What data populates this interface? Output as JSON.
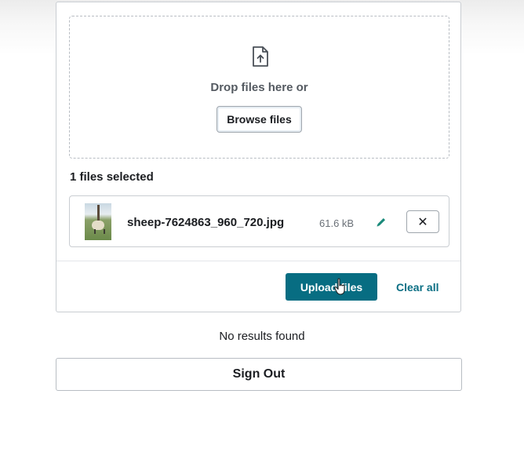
{
  "dropzone": {
    "icon": "file-upload-icon",
    "prompt": "Drop files here or",
    "browse_label": "Browse files"
  },
  "files": {
    "count_label": "1 files selected",
    "items": [
      {
        "name": "sheep-7624863_960_720.jpg",
        "size": "61.6 kB",
        "thumbnail": "sheep-photo-thumbnail",
        "edit_icon": "pencil-icon",
        "remove_icon": "close-icon",
        "remove_label": "✕"
      }
    ]
  },
  "actions": {
    "upload_label": "Upload files",
    "clear_label": "Clear all"
  },
  "results": {
    "empty_text": "No results found"
  },
  "auth": {
    "sign_out_label": "Sign Out"
  },
  "colors": {
    "primary": "#076d82",
    "link": "#0b6f84",
    "edit_icon": "#1a8a7a"
  }
}
